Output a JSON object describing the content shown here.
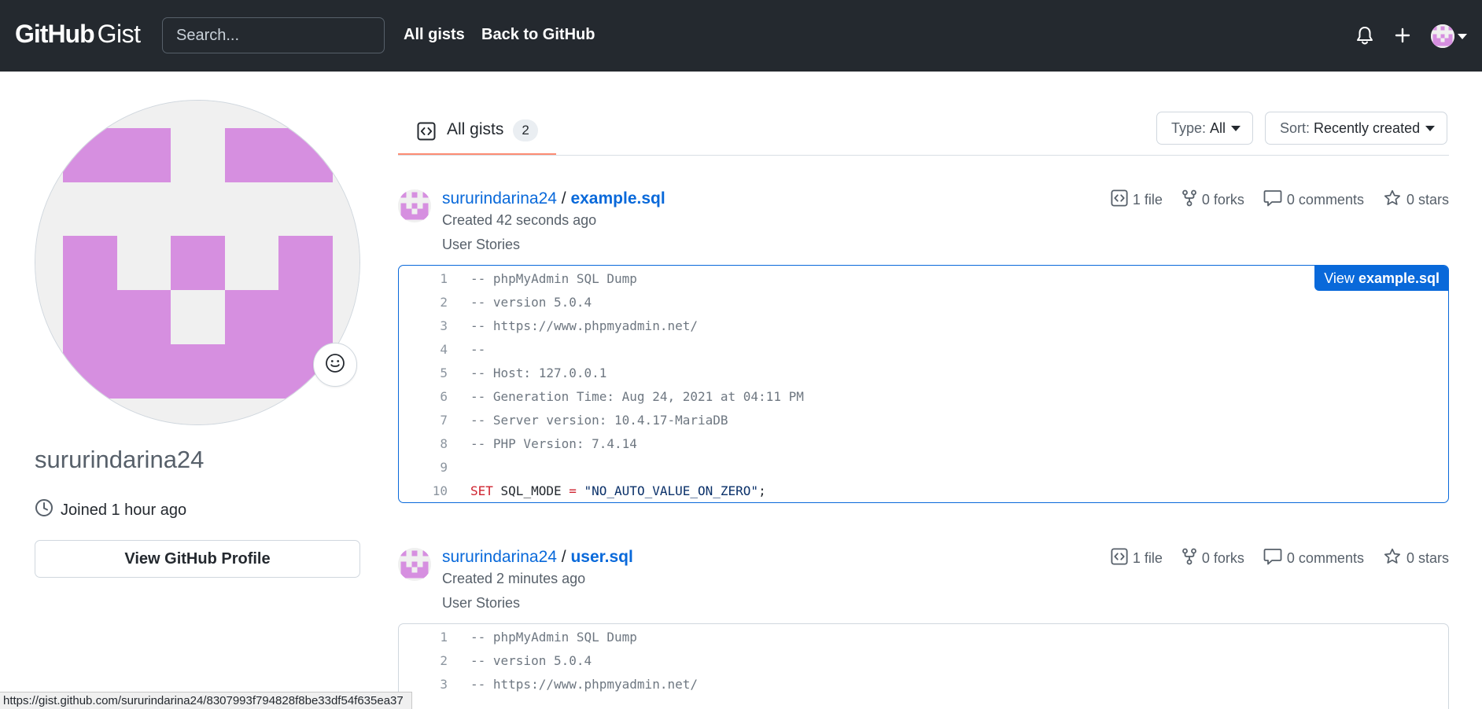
{
  "header": {
    "logo_github": "GitHub",
    "logo_gist": "Gist",
    "search_placeholder": "Search...",
    "nav": [
      "All gists",
      "Back to GitHub"
    ],
    "icons": [
      "bell-icon",
      "plus-icon",
      "avatar",
      "caret-down-icon"
    ]
  },
  "profile": {
    "username": "sururindarina24",
    "joined": "Joined 1 hour ago",
    "view_profile_label": "View GitHub Profile",
    "avatar_color": "#d68fe0"
  },
  "tabs": {
    "all_gists_label": "All gists",
    "all_gists_count": "2"
  },
  "filters": {
    "type_label": "Type:",
    "type_value": "All",
    "sort_label": "Sort:",
    "sort_value": "Recently created"
  },
  "gists": [
    {
      "owner": "sururindarina24",
      "separator": " / ",
      "filename": "example.sql",
      "created": "Created 42 seconds ago",
      "description": "User Stories",
      "stats": {
        "files": "1 file",
        "forks": "0 forks",
        "comments": "0 comments",
        "stars": "0 stars"
      },
      "view_label": "View",
      "view_file": "example.sql",
      "lines": [
        {
          "n": "1",
          "text": "-- phpMyAdmin SQL Dump"
        },
        {
          "n": "2",
          "text": "-- version 5.0.4"
        },
        {
          "n": "3",
          "text": "-- https://www.phpmyadmin.net/"
        },
        {
          "n": "4",
          "text": "--"
        },
        {
          "n": "5",
          "text": "-- Host: 127.0.0.1"
        },
        {
          "n": "6",
          "text": "-- Generation Time: Aug 24, 2021 at 04:11 PM"
        },
        {
          "n": "7",
          "text": "-- Server version: 10.4.17-MariaDB"
        },
        {
          "n": "8",
          "text": "-- PHP Version: 7.4.14"
        },
        {
          "n": "9",
          "text": ""
        },
        {
          "n": "10",
          "kw": "SET",
          "ident": " SQL_MODE ",
          "op": "=",
          "str": " \"NO_AUTO_VALUE_ON_ZERO\"",
          "end": ";"
        }
      ]
    },
    {
      "owner": "sururindarina24",
      "separator": " / ",
      "filename": "user.sql",
      "created": "Created 2 minutes ago",
      "description": "User Stories",
      "stats": {
        "files": "1 file",
        "forks": "0 forks",
        "comments": "0 comments",
        "stars": "0 stars"
      },
      "lines": [
        {
          "n": "1",
          "text": "-- phpMyAdmin SQL Dump"
        },
        {
          "n": "2",
          "text": "-- version 5.0.4"
        },
        {
          "n": "3",
          "text": "-- https://www.phpmyadmin.net/"
        }
      ]
    }
  ],
  "statusbar": {
    "url": "https://gist.github.com/sururindarina24/8307993f794828f8be33df54f635ea37"
  }
}
